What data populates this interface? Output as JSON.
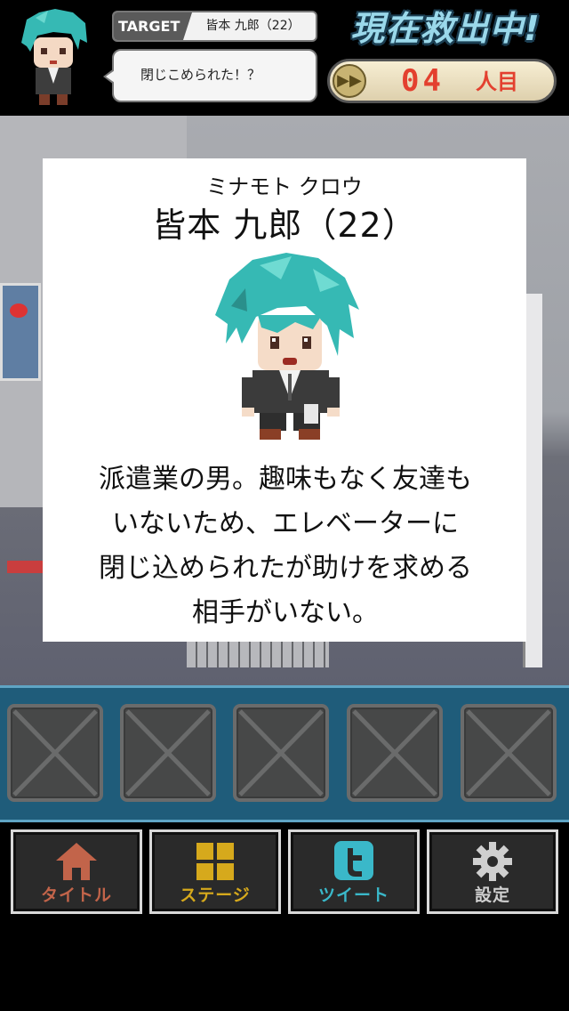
{
  "header": {
    "target_tag": "TARGET",
    "target_name": "皆本 九郎（22）",
    "speech": "閉じこめられた！？",
    "rescue_title": "現在救出中!",
    "counter_number": "04",
    "counter_unit": "人目"
  },
  "profile": {
    "kana": "ミナモト クロウ",
    "name": "皆本 九郎（22）",
    "description_lines": [
      "派遣業の男。趣味もなく友達も",
      "いないため、エレベーターに",
      "閉じ込められたが助けを求める",
      "相手がいない。"
    ]
  },
  "inventory": {
    "slots": [
      "empty",
      "empty",
      "empty",
      "empty",
      "empty"
    ]
  },
  "nav": {
    "title_label": "タイトル",
    "stage_label": "ステージ",
    "tweet_label": "ツイート",
    "settings_label": "設定"
  },
  "colors": {
    "target_hair": "#36b9b4",
    "counter_red": "#e3402f",
    "title_blue": "#9ad8ea",
    "nav_title": "#c2644a",
    "nav_stage": "#d6a91c",
    "nav_tweet": "#3ab8c9",
    "nav_settings": "#cfcfcf",
    "inventory_bg": "#1f5c7a"
  },
  "icons": {
    "title": "home-icon",
    "stage": "grid-icon",
    "tweet": "twitter-icon",
    "settings": "gear-icon",
    "counter": "fast-forward-icon"
  }
}
